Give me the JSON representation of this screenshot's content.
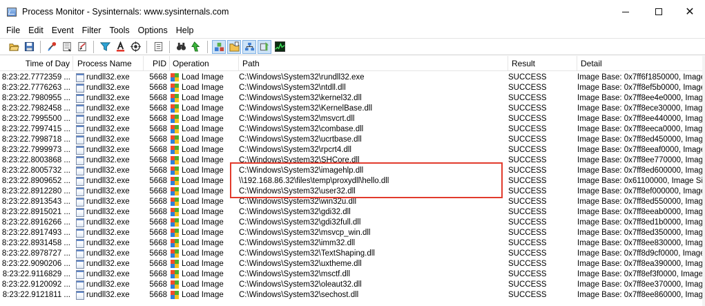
{
  "window": {
    "title": "Process Monitor - Sysinternals: www.sysinternals.com",
    "minimize_label": "—",
    "maximize_label": "☐",
    "close_label": "✕"
  },
  "menu": [
    "File",
    "Edit",
    "Event",
    "Filter",
    "Tools",
    "Options",
    "Help"
  ],
  "toolbar_icons": [
    "open-icon",
    "save-icon",
    "autoscroll-icon",
    "clear-icon",
    "filter-icon",
    "highlight-icon",
    "include-process-icon",
    "capture-target-icon",
    "properties-icon",
    "find-icon",
    "jump-to-icon",
    "registry-activity-icon",
    "file-activity-icon",
    "network-activity-icon",
    "process-activity-icon",
    "profiling-icon"
  ],
  "columns": {
    "time": "Time of Day",
    "process": "Process Name",
    "pid": "PID",
    "operation": "Operation",
    "path": "Path",
    "result": "Result",
    "detail": "Detail"
  },
  "rows": [
    {
      "time": "8:23:22.7772359 ...",
      "process": "rundll32.exe",
      "pid": "5668",
      "operation": "Load Image",
      "path": "C:\\Windows\\System32\\rundll32.exe",
      "result": "SUCCESS",
      "detail": "Image Base: 0x7ff6f1850000, Image Siz"
    },
    {
      "time": "8:23:22.7776263 ...",
      "process": "rundll32.exe",
      "pid": "5668",
      "operation": "Load Image",
      "path": "C:\\Windows\\System32\\ntdll.dll",
      "result": "SUCCESS",
      "detail": "Image Base: 0x7ff8ef5b0000, Image Siz"
    },
    {
      "time": "8:23:22.7980955 ...",
      "process": "rundll32.exe",
      "pid": "5668",
      "operation": "Load Image",
      "path": "C:\\Windows\\System32\\kernel32.dll",
      "result": "SUCCESS",
      "detail": "Image Base: 0x7ff8ee4e0000, Image Siz"
    },
    {
      "time": "8:23:22.7982458 ...",
      "process": "rundll32.exe",
      "pid": "5668",
      "operation": "Load Image",
      "path": "C:\\Windows\\System32\\KernelBase.dll",
      "result": "SUCCESS",
      "detail": "Image Base: 0x7ff8ece30000, Image Siz"
    },
    {
      "time": "8:23:22.7995500 ...",
      "process": "rundll32.exe",
      "pid": "5668",
      "operation": "Load Image",
      "path": "C:\\Windows\\System32\\msvcrt.dll",
      "result": "SUCCESS",
      "detail": "Image Base: 0x7ff8ee440000, Image Siz"
    },
    {
      "time": "8:23:22.7997415 ...",
      "process": "rundll32.exe",
      "pid": "5668",
      "operation": "Load Image",
      "path": "C:\\Windows\\System32\\combase.dll",
      "result": "SUCCESS",
      "detail": "Image Base: 0x7ff8eeca0000, Image Siz"
    },
    {
      "time": "8:23:22.7998718 ...",
      "process": "rundll32.exe",
      "pid": "5668",
      "operation": "Load Image",
      "path": "C:\\Windows\\System32\\ucrtbase.dll",
      "result": "SUCCESS",
      "detail": "Image Base: 0x7ff8ed450000, Image Siz"
    },
    {
      "time": "8:23:22.7999973 ...",
      "process": "rundll32.exe",
      "pid": "5668",
      "operation": "Load Image",
      "path": "C:\\Windows\\System32\\rpcrt4.dll",
      "result": "SUCCESS",
      "detail": "Image Base: 0x7ff8eeaf0000, Image Siz"
    },
    {
      "time": "8:23:22.8003868 ...",
      "process": "rundll32.exe",
      "pid": "5668",
      "operation": "Load Image",
      "path": "C:\\Windows\\System32\\SHCore.dll",
      "result": "SUCCESS",
      "detail": "Image Base: 0x7ff8ee770000, Image Siz"
    },
    {
      "time": "8:23:22.8005732 ...",
      "process": "rundll32.exe",
      "pid": "5668",
      "operation": "Load Image",
      "path": "C:\\Windows\\System32\\imagehlp.dll",
      "result": "SUCCESS",
      "detail": "Image Base: 0x7ff8ed600000, Image Siz"
    },
    {
      "time": "8:23:22.8909652 ...",
      "process": "rundll32.exe",
      "pid": "5668",
      "operation": "Load Image",
      "path": "\\\\192.168.86.32\\files\\temp\\proxydll\\hello.dll",
      "result": "SUCCESS",
      "detail": "Image Base: 0x61100000, Image Size: 0"
    },
    {
      "time": "8:23:22.8912280 ...",
      "process": "rundll32.exe",
      "pid": "5668",
      "operation": "Load Image",
      "path": "C:\\Windows\\System32\\user32.dll",
      "result": "SUCCESS",
      "detail": "Image Base: 0x7ff8ef000000, Image Siz"
    },
    {
      "time": "8:23:22.8913543 ...",
      "process": "rundll32.exe",
      "pid": "5668",
      "operation": "Load Image",
      "path": "C:\\Windows\\System32\\win32u.dll",
      "result": "SUCCESS",
      "detail": "Image Base: 0x7ff8ed550000, Image Siz"
    },
    {
      "time": "8:23:22.8915021 ...",
      "process": "rundll32.exe",
      "pid": "5668",
      "operation": "Load Image",
      "path": "C:\\Windows\\System32\\gdi32.dll",
      "result": "SUCCESS",
      "detail": "Image Base: 0x7ff8eeab0000, Image Siz"
    },
    {
      "time": "8:23:22.8916266 ...",
      "process": "rundll32.exe",
      "pid": "5668",
      "operation": "Load Image",
      "path": "C:\\Windows\\System32\\gdi32full.dll",
      "result": "SUCCESS",
      "detail": "Image Base: 0x7ff8ed1b0000, Image Siz"
    },
    {
      "time": "8:23:22.8917493 ...",
      "process": "rundll32.exe",
      "pid": "5668",
      "operation": "Load Image",
      "path": "C:\\Windows\\System32\\msvcp_win.dll",
      "result": "SUCCESS",
      "detail": "Image Base: 0x7ff8ed350000, Image Siz"
    },
    {
      "time": "8:23:22.8931458 ...",
      "process": "rundll32.exe",
      "pid": "5668",
      "operation": "Load Image",
      "path": "C:\\Windows\\System32\\imm32.dll",
      "result": "SUCCESS",
      "detail": "Image Base: 0x7ff8ee830000, Image Siz"
    },
    {
      "time": "8:23:22.8978727 ...",
      "process": "rundll32.exe",
      "pid": "5668",
      "operation": "Load Image",
      "path": "C:\\Windows\\System32\\TextShaping.dll",
      "result": "SUCCESS",
      "detail": "Image Base: 0x7ff8d9cf0000, Image Siz"
    },
    {
      "time": "8:23:22.9090206 ...",
      "process": "rundll32.exe",
      "pid": "5668",
      "operation": "Load Image",
      "path": "C:\\Windows\\System32\\uxtheme.dll",
      "result": "SUCCESS",
      "detail": "Image Base: 0x7ff8ea390000, Image Siz"
    },
    {
      "time": "8:23:22.9116829 ...",
      "process": "rundll32.exe",
      "pid": "5668",
      "operation": "Load Image",
      "path": "C:\\Windows\\System32\\msctf.dll",
      "result": "SUCCESS",
      "detail": "Image Base: 0x7ff8ef3f0000, Image Siz"
    },
    {
      "time": "8:23:22.9120092 ...",
      "process": "rundll32.exe",
      "pid": "5668",
      "operation": "Load Image",
      "path": "C:\\Windows\\System32\\oleaut32.dll",
      "result": "SUCCESS",
      "detail": "Image Base: 0x7ff8ee370000, Image Siz"
    },
    {
      "time": "8:23:22.9121811 ...",
      "process": "rundll32.exe",
      "pid": "5668",
      "operation": "Load Image",
      "path": "C:\\Windows\\System32\\sechost.dll",
      "result": "SUCCESS",
      "detail": "Image Base: 0x7ff8ee860000, Image Siz"
    }
  ],
  "colors": {
    "highlight_box": "#e23a2c",
    "toolbar_pressed": "#cde3f7"
  }
}
